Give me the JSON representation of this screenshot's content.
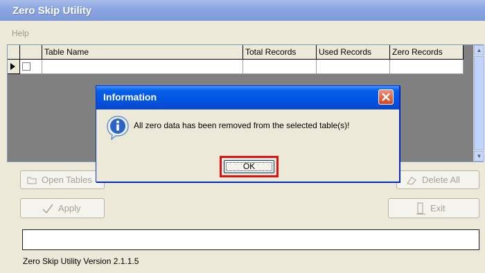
{
  "window": {
    "title": "Zero Skip Utility"
  },
  "menu": {
    "help": "Help"
  },
  "grid": {
    "columns": [
      "Table Name",
      "Total Records",
      "Used Records",
      "Zero Records"
    ]
  },
  "buttons": {
    "open_tables": "Open Tables",
    "delete_all": "Delete All",
    "apply": "Apply",
    "exit": "Exit"
  },
  "status": {
    "value": ""
  },
  "footer": {
    "version": "Zero Skip Utility Version  2.1.1.5"
  },
  "dialog": {
    "title": "Information",
    "message": "All zero data has been removed from the selected table(s)!",
    "ok": "OK",
    "highlight_color": "#e01010",
    "icon": "info-icon"
  }
}
